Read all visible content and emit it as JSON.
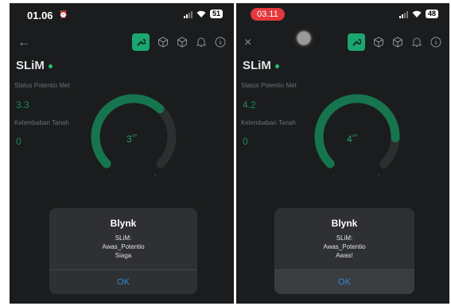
{
  "phones": [
    {
      "status_time": "01.06",
      "battery": "51",
      "nav_icon": "back-arrow-icon",
      "app_title": "SLiM",
      "potentio_label": "Status Potentio Met",
      "potentio_value": "3.3",
      "moisture_label": "Kelembaban Tanah",
      "moisture_value": "0",
      "gauge": {
        "value": "3",
        "level": 0.66
      },
      "dialog": {
        "title": "Blynk",
        "line1": "SLiM:",
        "line2": "Awas_Potentio",
        "line3": "Siaga",
        "ok": "OK"
      }
    },
    {
      "status_time": "03.11",
      "battery": "48",
      "nav_icon": "close-icon",
      "app_title": "SLiM",
      "potentio_label": "Status Potentio Met",
      "potentio_value": "4.2",
      "moisture_label": "Kelembaban Tanah",
      "moisture_value": "0",
      "gauge": {
        "value": "4",
        "level": 0.84
      },
      "dialog": {
        "title": "Blynk",
        "line1": "SLiM:",
        "line2": "Awas_Potentio",
        "line3": "Awas!",
        "ok": "OK"
      }
    }
  ],
  "colors": {
    "background": "#1a1c1d",
    "accent": "#1ba56f",
    "gauge_fill": "#16754f",
    "gauge_track": "#2c2e30",
    "link": "#2f8bd8"
  }
}
